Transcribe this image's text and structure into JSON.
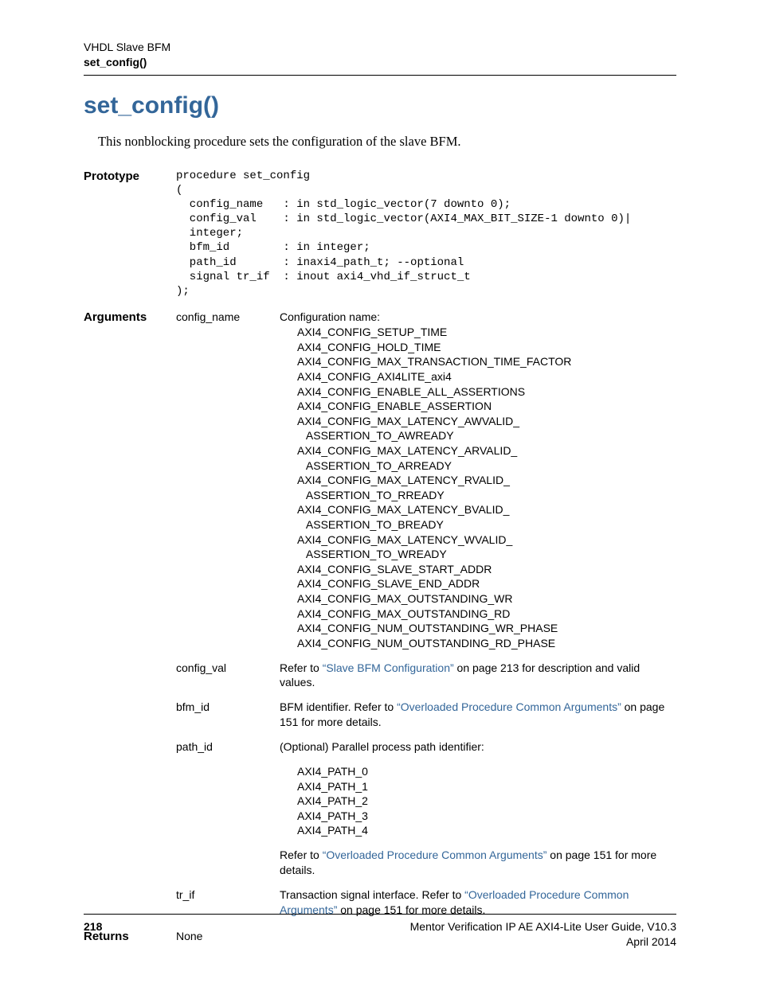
{
  "header": {
    "line1": "VHDL Slave BFM",
    "line2": "set_config()"
  },
  "title": "set_config()",
  "intro": "This nonblocking procedure sets the configuration of the slave BFM.",
  "prototype": {
    "label": "Prototype",
    "code": "procedure set_config\n(\n  config_name   : in std_logic_vector(7 downto 0);\n  config_val    : in std_logic_vector(AXI4_MAX_BIT_SIZE-1 downto 0)|\n  integer;\n  bfm_id        : in integer;\n  path_id       : inaxi4_path_t; --optional\n  signal tr_if  : inout axi4_vhd_if_struct_t\n);"
  },
  "arguments": {
    "label": "Arguments",
    "config_name": {
      "name": "config_name",
      "desc_lead": "Configuration name:",
      "list": "AXI4_CONFIG_SETUP_TIME\nAXI4_CONFIG_HOLD_TIME\nAXI4_CONFIG_MAX_TRANSACTION_TIME_FACTOR\nAXI4_CONFIG_AXI4LITE_axi4\nAXI4_CONFIG_ENABLE_ALL_ASSERTIONS\nAXI4_CONFIG_ENABLE_ASSERTION\nAXI4_CONFIG_MAX_LATENCY_AWVALID_\n   ASSERTION_TO_AWREADY\nAXI4_CONFIG_MAX_LATENCY_ARVALID_\n   ASSERTION_TO_ARREADY\nAXI4_CONFIG_MAX_LATENCY_RVALID_\n   ASSERTION_TO_RREADY\nAXI4_CONFIG_MAX_LATENCY_BVALID_\n   ASSERTION_TO_BREADY\nAXI4_CONFIG_MAX_LATENCY_WVALID_\n   ASSERTION_TO_WREADY\nAXI4_CONFIG_SLAVE_START_ADDR\nAXI4_CONFIG_SLAVE_END_ADDR\nAXI4_CONFIG_MAX_OUTSTANDING_WR\nAXI4_CONFIG_MAX_OUTSTANDING_RD\nAXI4_CONFIG_NUM_OUTSTANDING_WR_PHASE\nAXI4_CONFIG_NUM_OUTSTANDING_RD_PHASE"
    },
    "config_val": {
      "name": "config_val",
      "pre": "Refer to ",
      "link": "“Slave BFM Configuration”",
      "post": " on page 213 for description and valid values."
    },
    "bfm_id": {
      "name": "bfm_id",
      "pre": "BFM identifier. Refer to ",
      "link": "“Overloaded Procedure Common Arguments”",
      "post": " on page 151 for more details."
    },
    "path_id": {
      "name": "path_id",
      "desc_lead": "(Optional) Parallel process path identifier:",
      "list": "AXI4_PATH_0\nAXI4_PATH_1\nAXI4_PATH_2\nAXI4_PATH_3\nAXI4_PATH_4",
      "pre2": "Refer to ",
      "link2": "“Overloaded Procedure Common Arguments”",
      "post2": " on page 151 for more details."
    },
    "tr_if": {
      "name": "tr_if",
      "pre": "Transaction signal interface. Refer to ",
      "link": "“Overloaded Procedure Common Arguments”",
      "post": " on page 151 for more details."
    }
  },
  "returns": {
    "label": "Returns",
    "value": "None"
  },
  "footer": {
    "page": "218",
    "right1": "Mentor Verification IP AE AXI4-Lite User Guide, V10.3",
    "right2": "April 2014"
  }
}
